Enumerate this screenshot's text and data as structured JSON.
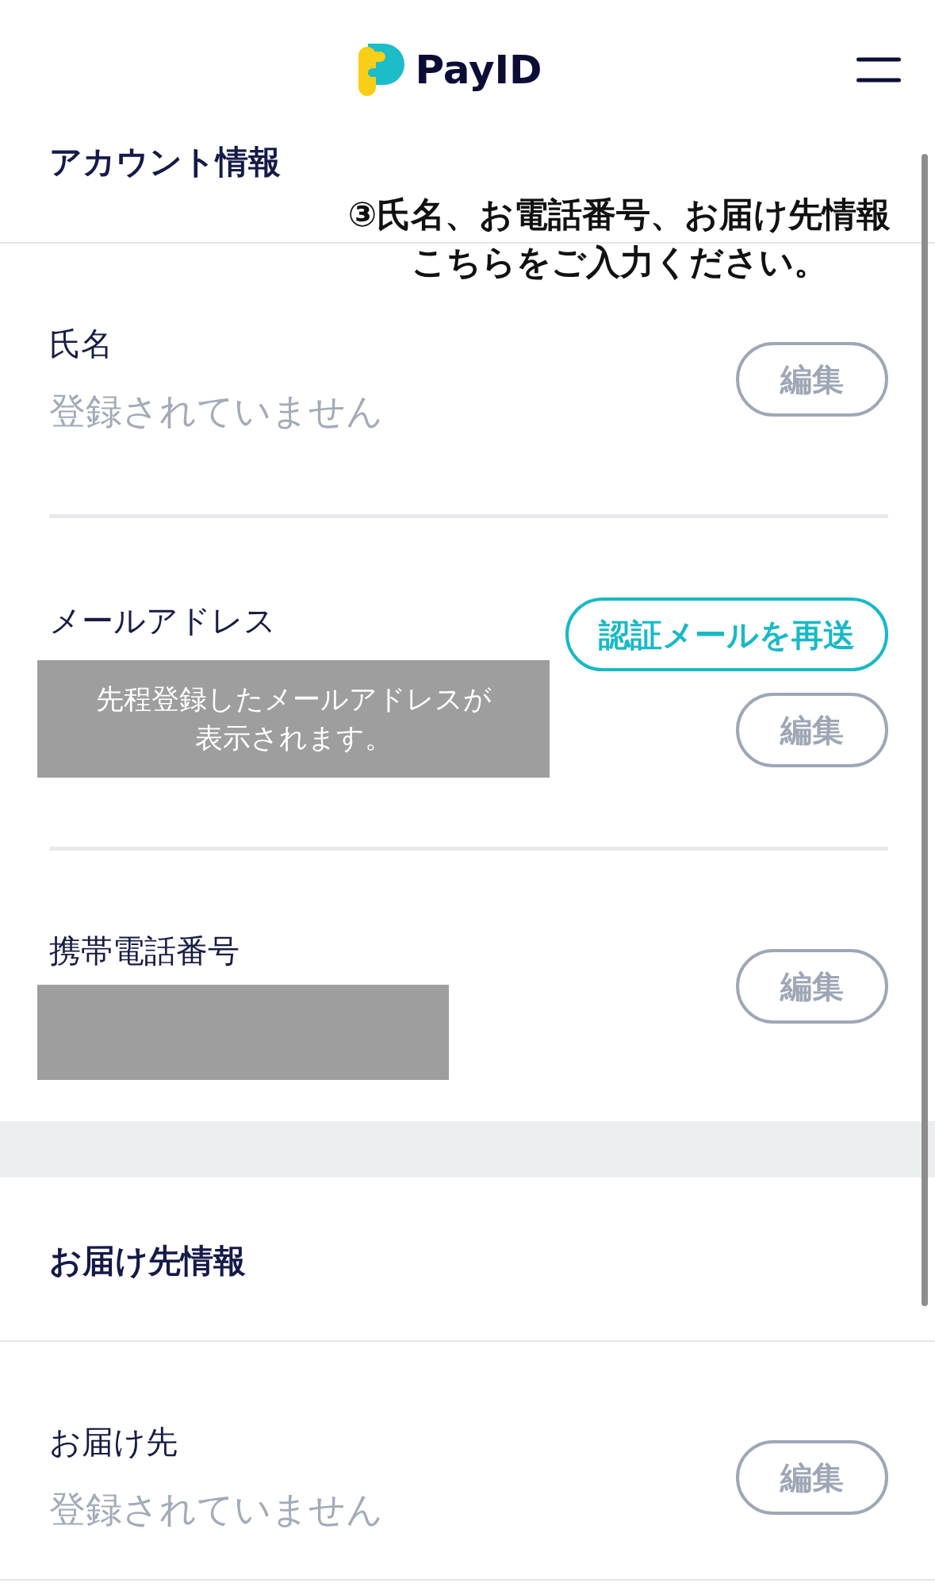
{
  "header": {
    "logo_text": "PayID"
  },
  "annotation": {
    "text": "③氏名、お電話番号、お届け先情報こちらをご入力ください。"
  },
  "sections": [
    {
      "title": "アカウント情報",
      "fields": [
        {
          "label": "氏名",
          "kind": "unset",
          "value": "登録されていません",
          "actions": [
            {
              "label": "編集",
              "kind": "outline"
            }
          ]
        },
        {
          "label": "メールアドレス",
          "kind": "redacted",
          "note": "先程登録したメールアドレスが表示されます。",
          "actions": [
            {
              "label": "認証メールを再送",
              "kind": "accent"
            },
            {
              "label": "編集",
              "kind": "outline"
            }
          ]
        },
        {
          "label": "携帯電話番号",
          "kind": "redacted",
          "actions": [
            {
              "label": "編集",
              "kind": "outline"
            }
          ]
        }
      ]
    },
    {
      "title": "お届け先情報",
      "fields": [
        {
          "label": "お届け先",
          "kind": "unset",
          "value": "登録されていません",
          "actions": [
            {
              "label": "編集",
              "kind": "outline"
            }
          ]
        }
      ]
    }
  ]
}
